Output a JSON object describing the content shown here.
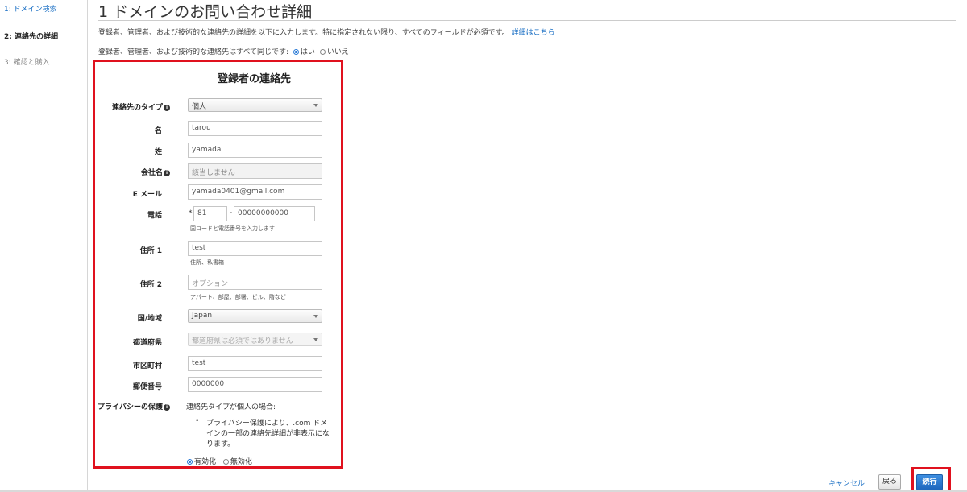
{
  "sidebar": {
    "steps": [
      {
        "label": "1: ドメイン検索"
      },
      {
        "label": "2: 連絡先の詳細"
      },
      {
        "label": "3: 確認と購入"
      }
    ]
  },
  "header": {
    "title": "1 ドメインのお問い合わせ詳細",
    "intro": "登録者、管理者、および技術的な連絡先の詳細を以下に入力します。特に指定されない限り、すべてのフィールドが必須です。",
    "intro_link": "詳細はこちら",
    "same_question": "登録者、管理者、および技術的な連絡先はすべて同じです:",
    "same_yes": "はい",
    "same_no": "いいえ"
  },
  "form": {
    "title": "登録者の連絡先",
    "contact_type": {
      "label": "連絡先のタイプ",
      "value": "個人"
    },
    "first_name": {
      "label": "名",
      "value": "tarou"
    },
    "last_name": {
      "label": "姓",
      "value": "yamada"
    },
    "company": {
      "label": "会社名",
      "placeholder": "該当しません"
    },
    "email": {
      "label": "E メール",
      "value": "yamada0401@gmail.com"
    },
    "phone": {
      "label": "電話",
      "required_mark": "*",
      "country_code": "81",
      "separator": "-",
      "number": "00000000000",
      "hint": "国コードと電話番号を入力します"
    },
    "address1": {
      "label": "住所 1",
      "value": "test",
      "hint": "住所、私書箱"
    },
    "address2": {
      "label": "住所 2",
      "placeholder": "オプション",
      "hint": "アパート、部屋、部署、ビル、階など"
    },
    "country": {
      "label": "国/地域",
      "value": "Japan"
    },
    "state": {
      "label": "都道府県",
      "value": "都道府県は必須ではありません"
    },
    "city": {
      "label": "市区町村",
      "value": "test"
    },
    "postal": {
      "label": "郵便番号",
      "value": "0000000"
    },
    "privacy": {
      "label": "プライバシーの保護",
      "note": "連絡先タイプが個人の場合:",
      "bullet_1": "プライバシー保護により、.com ドメ",
      "bullet_2": "インの一部の連絡先詳細が非表示にな",
      "bullet_3": "ります。",
      "enable": "有効化",
      "disable": "無効化"
    }
  },
  "footer": {
    "cancel": "キャンセル",
    "back": "戻る",
    "next": "続行"
  },
  "colors": {
    "accent": "#1a6fc4",
    "highlight": "#e0111e",
    "primary_button": "#2270c8"
  }
}
